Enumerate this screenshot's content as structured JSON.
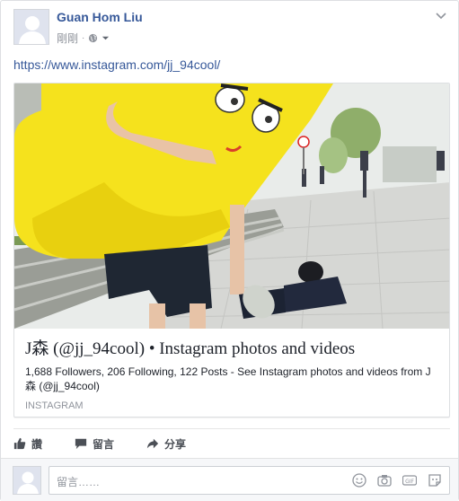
{
  "post": {
    "author": "Guan Hom Liu",
    "timestamp": "剛剛",
    "privacy_icon": "globe-icon",
    "link_url": "https://www.instagram.com/jj_94cool/"
  },
  "card": {
    "title": "J森 (@jj_94cool) • Instagram photos and videos",
    "description": "1,688 Followers, 206 Following, 122 Posts - See Instagram photos and videos from J森 (@jj_94cool)",
    "domain": "INSTAGRAM"
  },
  "actions": {
    "like": "讚",
    "comment": "留言",
    "share": "分享"
  },
  "composer": {
    "placeholder": "留言……",
    "icons": [
      "emoji-icon",
      "camera-icon",
      "gif-icon",
      "sticker-icon"
    ]
  },
  "colors": {
    "link": "#365899",
    "muted": "#90949c",
    "border": "#dddfe2"
  }
}
